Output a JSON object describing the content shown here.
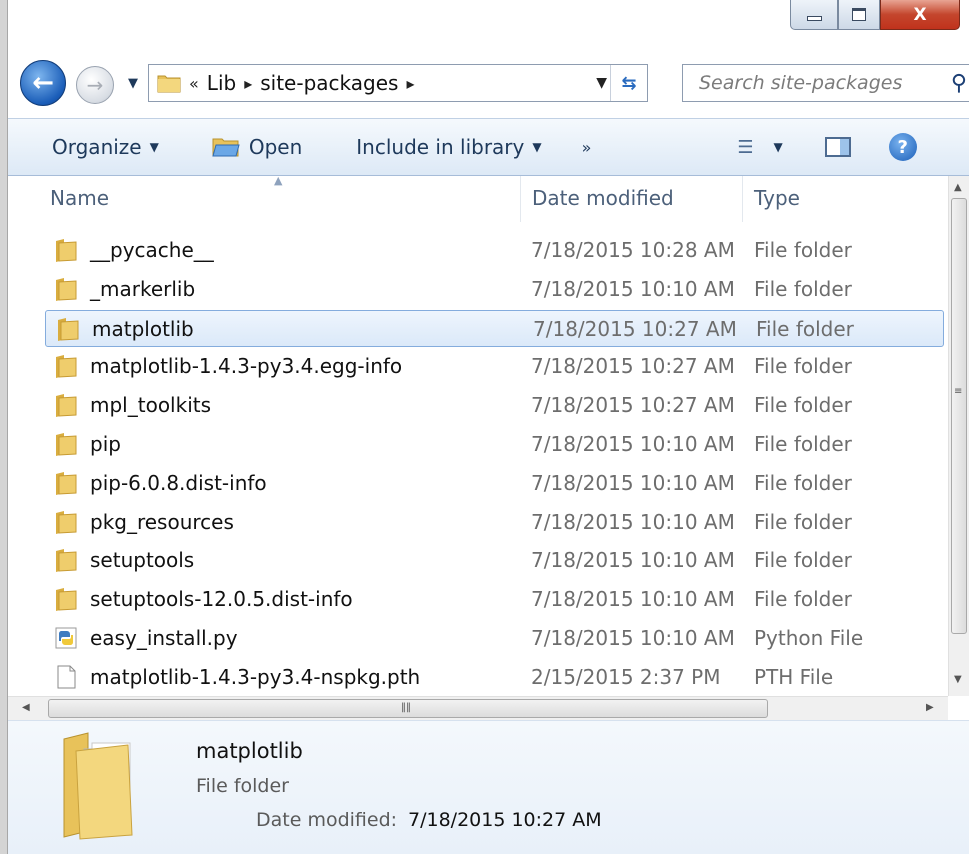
{
  "address": {
    "overflow_glyph": "«",
    "crumbs": [
      "Lib",
      "site-packages"
    ],
    "separator": "▸"
  },
  "search": {
    "placeholder": "Search site-packages"
  },
  "toolbar": {
    "organize": "Organize",
    "open": "Open",
    "include_in_library": "Include in library",
    "more": "»"
  },
  "columns": {
    "name": "Name",
    "date_modified": "Date modified",
    "type": "Type"
  },
  "files": [
    {
      "name": "__pycache__",
      "date": "7/18/2015 10:28 AM",
      "type": "File folder",
      "icon": "folder-icon"
    },
    {
      "name": "_markerlib",
      "date": "7/18/2015 10:10 AM",
      "type": "File folder",
      "icon": "folder-icon"
    },
    {
      "name": "matplotlib",
      "date": "7/18/2015 10:27 AM",
      "type": "File folder",
      "icon": "folder-icon",
      "selected": true
    },
    {
      "name": "matplotlib-1.4.3-py3.4.egg-info",
      "date": "7/18/2015 10:27 AM",
      "type": "File folder",
      "icon": "folder-icon"
    },
    {
      "name": "mpl_toolkits",
      "date": "7/18/2015 10:27 AM",
      "type": "File folder",
      "icon": "folder-icon"
    },
    {
      "name": "pip",
      "date": "7/18/2015 10:10 AM",
      "type": "File folder",
      "icon": "folder-icon"
    },
    {
      "name": "pip-6.0.8.dist-info",
      "date": "7/18/2015 10:10 AM",
      "type": "File folder",
      "icon": "folder-icon"
    },
    {
      "name": "pkg_resources",
      "date": "7/18/2015 10:10 AM",
      "type": "File folder",
      "icon": "folder-icon"
    },
    {
      "name": "setuptools",
      "date": "7/18/2015 10:10 AM",
      "type": "File folder",
      "icon": "folder-icon"
    },
    {
      "name": "setuptools-12.0.5.dist-info",
      "date": "7/18/2015 10:10 AM",
      "type": "File folder",
      "icon": "folder-icon"
    },
    {
      "name": "easy_install.py",
      "date": "7/18/2015 10:10 AM",
      "type": "Python File",
      "icon": "python-file-icon"
    },
    {
      "name": "matplotlib-1.4.3-py3.4-nspkg.pth",
      "date": "2/15/2015 2:37 PM",
      "type": "PTH File",
      "icon": "document-icon"
    }
  ],
  "details": {
    "name": "matplotlib",
    "type": "File folder",
    "date_label": "Date modified:",
    "date_value": "7/18/2015 10:27 AM"
  },
  "window": {
    "close_glyph": "X"
  },
  "colors": {
    "selection": "#dbe9f9",
    "selection_border": "#84acdd",
    "toolbar_text": "#1e395b",
    "folder": "#e8c25a"
  }
}
